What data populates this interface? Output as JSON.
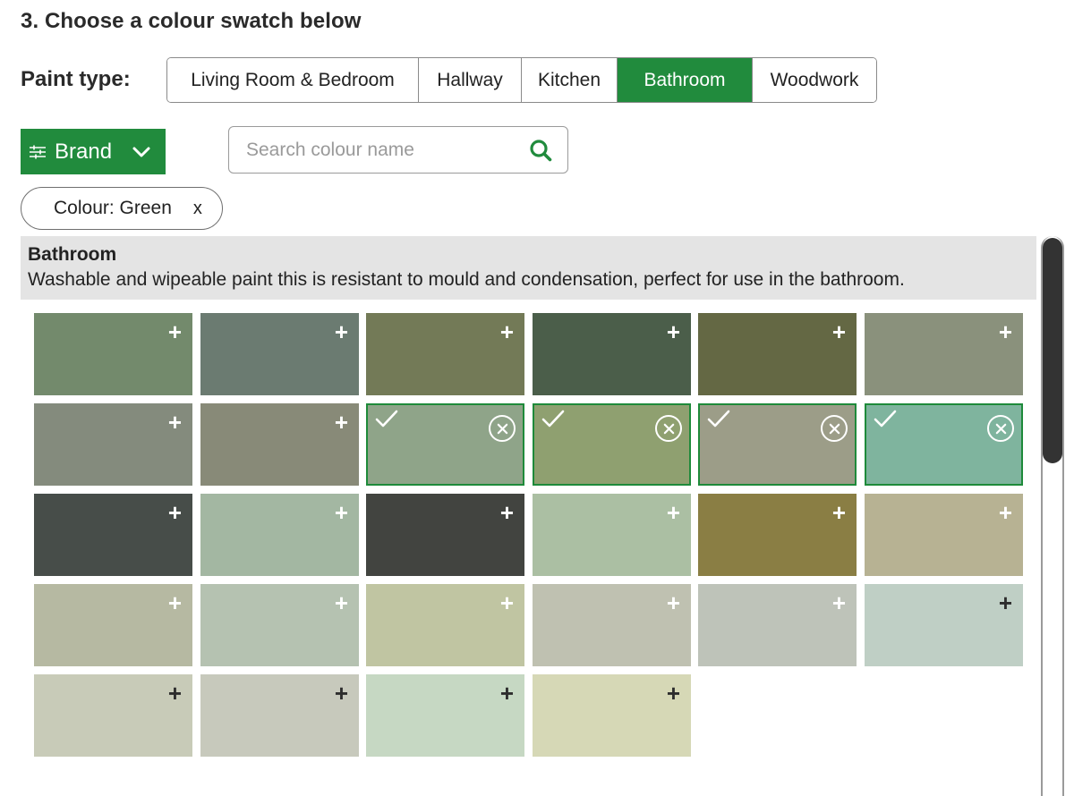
{
  "step_title": "3. Choose a colour swatch below",
  "paint_type": {
    "label": "Paint type:",
    "tabs": [
      {
        "label": "Living Room & Bedroom",
        "active": false
      },
      {
        "label": "Hallway",
        "active": false
      },
      {
        "label": "Kitchen",
        "active": false
      },
      {
        "label": "Bathroom",
        "active": true
      },
      {
        "label": "Woodwork",
        "active": false
      }
    ]
  },
  "brand_filter": {
    "label": "Brand"
  },
  "search": {
    "placeholder": "Search colour name",
    "value": ""
  },
  "active_filter_chip": {
    "label": "Colour: Green",
    "remove_label": "x"
  },
  "category": {
    "title": "Bathroom",
    "description": "Washable and wipeable paint this is resistant to mould and condensation, perfect for use in the bathroom."
  },
  "colors": {
    "accent": "#218b3d",
    "selected_border": "#1e8a3a",
    "band_bg": "#e4e4e4",
    "scrollbar": "#333333"
  },
  "swatch_add_symbol": "+",
  "swatches": [
    {
      "color": "#738a6c",
      "selected": false,
      "dark_plus": false
    },
    {
      "color": "#6b7b71",
      "selected": false,
      "dark_plus": false
    },
    {
      "color": "#737a57",
      "selected": false,
      "dark_plus": false
    },
    {
      "color": "#4b5e4a",
      "selected": false,
      "dark_plus": false
    },
    {
      "color": "#646844",
      "selected": false,
      "dark_plus": false
    },
    {
      "color": "#8a917c",
      "selected": false,
      "dark_plus": false
    },
    {
      "color": "#848b7d",
      "selected": false,
      "dark_plus": false
    },
    {
      "color": "#888a78",
      "selected": false,
      "dark_plus": false
    },
    {
      "color": "#8fa489",
      "selected": true,
      "dark_plus": false
    },
    {
      "color": "#8fa070",
      "selected": true,
      "dark_plus": false
    },
    {
      "color": "#9c9d88",
      "selected": true,
      "dark_plus": false
    },
    {
      "color": "#7fb49e",
      "selected": true,
      "dark_plus": false
    },
    {
      "color": "#474d49",
      "selected": false,
      "dark_plus": false
    },
    {
      "color": "#a3b7a2",
      "selected": false,
      "dark_plus": false
    },
    {
      "color": "#424440",
      "selected": false,
      "dark_plus": false
    },
    {
      "color": "#abbfa3",
      "selected": false,
      "dark_plus": false
    },
    {
      "color": "#8a7e44",
      "selected": false,
      "dark_plus": false
    },
    {
      "color": "#b7b293",
      "selected": false,
      "dark_plus": false
    },
    {
      "color": "#b6b9a2",
      "selected": false,
      "dark_plus": false
    },
    {
      "color": "#b5c2b1",
      "selected": false,
      "dark_plus": false
    },
    {
      "color": "#c0c5a2",
      "selected": false,
      "dark_plus": false
    },
    {
      "color": "#bfc1b1",
      "selected": false,
      "dark_plus": false
    },
    {
      "color": "#bec3b9",
      "selected": false,
      "dark_plus": false
    },
    {
      "color": "#bfcfc5",
      "selected": false,
      "dark_plus": true
    },
    {
      "color": "#c8cbb8",
      "selected": false,
      "dark_plus": true
    },
    {
      "color": "#c7c9bc",
      "selected": false,
      "dark_plus": true
    },
    {
      "color": "#c6d8c3",
      "selected": false,
      "dark_plus": true
    },
    {
      "color": "#d6d8b6",
      "selected": false,
      "dark_plus": true
    }
  ]
}
